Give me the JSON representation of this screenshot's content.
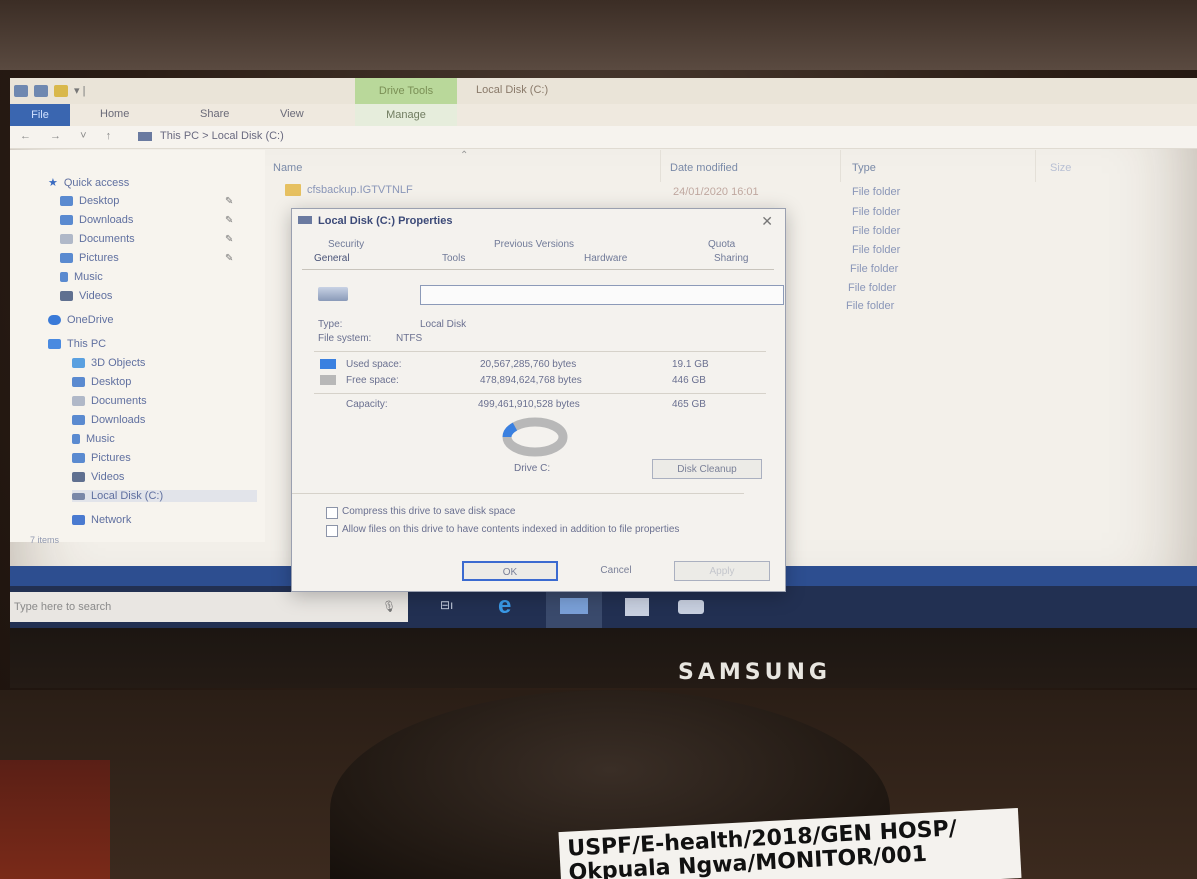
{
  "window": {
    "title": "Local Disk (C:)",
    "contextual_tab": "Drive Tools",
    "ribbon_tabs": [
      "File",
      "Home",
      "Share",
      "View",
      "Manage"
    ],
    "address": "This PC > Local Disk (C:)"
  },
  "nav_pane": {
    "quick_access": "Quick access",
    "pinned": [
      "Desktop",
      "Downloads",
      "Documents",
      "Pictures"
    ],
    "unpinned": [
      "Music",
      "Videos"
    ],
    "onedrive": "OneDrive",
    "this_pc": "This PC",
    "this_pc_items": [
      "3D Objects",
      "Desktop",
      "Documents",
      "Downloads",
      "Music",
      "Pictures",
      "Videos",
      "Local Disk (C:)"
    ],
    "network": "Network",
    "status": "7 items"
  },
  "file_list": {
    "columns": [
      "Name",
      "Date modified",
      "Type",
      "Size"
    ],
    "rows": [
      {
        "name": "cfsbackup.IGTVTNLF",
        "date": "24/01/2020 16:01",
        "type": "File folder"
      },
      {
        "name": "",
        "date": "",
        "type": "File folder"
      },
      {
        "name": "",
        "date": "",
        "type": "File folder"
      },
      {
        "name": "",
        "date": "",
        "type": "File folder"
      },
      {
        "name": "",
        "date": "",
        "type": "File folder"
      },
      {
        "name": "",
        "date": "",
        "type": "File folder"
      },
      {
        "name": "",
        "date": "",
        "type": "File folder"
      }
    ]
  },
  "taskbar": {
    "search_placeholder": "Type here to search"
  },
  "dialog": {
    "title": "Local Disk (C:) Properties",
    "tabs_top": [
      "Security",
      "Previous Versions",
      "Quota"
    ],
    "tabs_bottom": [
      "General",
      "Tools",
      "Hardware",
      "Sharing"
    ],
    "type_label": "Type:",
    "type_value": "Local Disk",
    "fs_label": "File system:",
    "fs_value": "NTFS",
    "used_label": "Used space:",
    "used_bytes": "20,567,285,760 bytes",
    "used_gb": "19.1 GB",
    "free_label": "Free space:",
    "free_bytes": "478,894,624,768 bytes",
    "free_gb": "446 GB",
    "capacity_label": "Capacity:",
    "capacity_bytes": "499,461,910,528 bytes",
    "capacity_gb": "465 GB",
    "drive_label": "Drive C:",
    "cleanup_button": "Disk Cleanup",
    "compress_label": "Compress this drive to save disk space",
    "index_label": "Allow files on this drive to have contents indexed in addition to file properties",
    "ok_button": "OK",
    "cancel_button": "Cancel",
    "apply_button": "Apply",
    "used_fraction": 0.041,
    "colors": {
      "used": "#3a80e0",
      "free": "#b8b8b8"
    }
  },
  "hardware": {
    "brand": "SAMSUNG",
    "sticker_line1": "USPF/E-health/2018/GEN HOSP/",
    "sticker_line2": "Okpuala Ngwa/MONITOR/001"
  }
}
